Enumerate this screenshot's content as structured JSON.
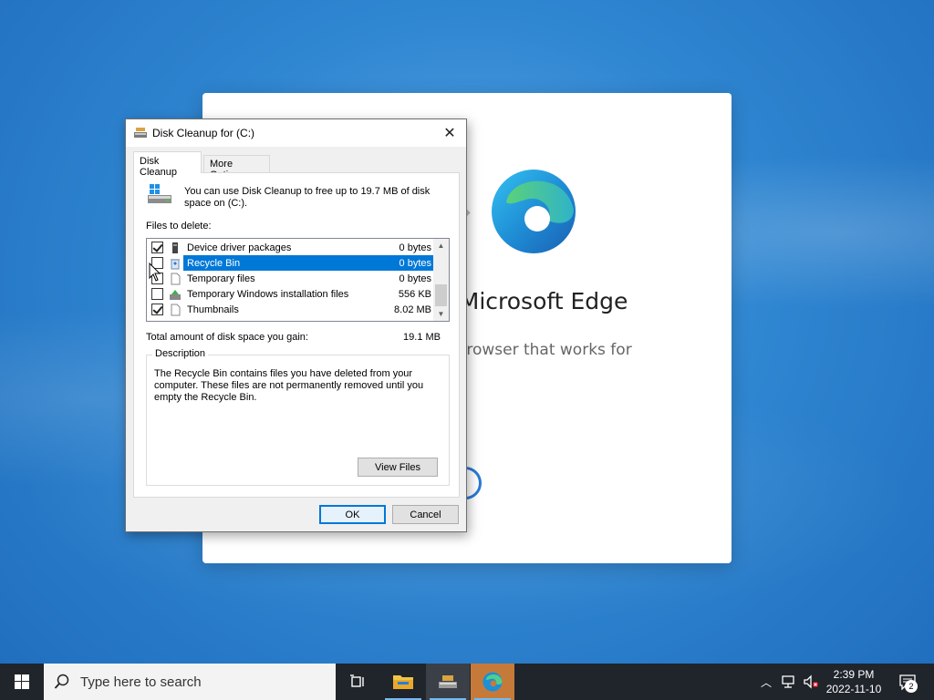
{
  "edge_window": {
    "heading": "ew Microsoft Edge",
    "subtitle_line1": "web browser that works for",
    "subtitle_line2": "u"
  },
  "dialog": {
    "title": "Disk Cleanup for  (C:)",
    "tabs": [
      {
        "label": "Disk Cleanup",
        "active": true
      },
      {
        "label": "More Options",
        "active": false
      }
    ],
    "intro_text": "You can use Disk Cleanup to free up to 19.7 MB of disk space on  (C:).",
    "files_label": "Files to delete:",
    "files": [
      {
        "name": "Device driver packages",
        "size": "0 bytes",
        "checked": true,
        "selected": false,
        "icon": "driver-icon"
      },
      {
        "name": "Recycle Bin",
        "size": "0 bytes",
        "checked": false,
        "selected": true,
        "icon": "recycle-bin-icon"
      },
      {
        "name": "Temporary files",
        "size": "0 bytes",
        "checked": false,
        "selected": false,
        "icon": "file-icon"
      },
      {
        "name": "Temporary Windows installation files",
        "size": "556 KB",
        "checked": false,
        "selected": false,
        "icon": "windows-setup-icon"
      },
      {
        "name": "Thumbnails",
        "size": "8.02 MB",
        "checked": true,
        "selected": false,
        "icon": "file-icon"
      }
    ],
    "total_label": "Total amount of disk space you gain:",
    "total_value": "19.1 MB",
    "description_legend": "Description",
    "description_text": "The Recycle Bin contains files you have deleted from your computer. These files are not permanently removed until you empty the Recycle Bin.",
    "view_files_label": "View Files",
    "ok_label": "OK",
    "cancel_label": "Cancel"
  },
  "taskbar": {
    "search_placeholder": "Type here to search",
    "time": "2:39 PM",
    "date": "2022-11-10",
    "notification_count": "2"
  },
  "colors": {
    "selection": "#0078d7",
    "taskbar": "#20242b",
    "desktop": "#2f86d1"
  }
}
